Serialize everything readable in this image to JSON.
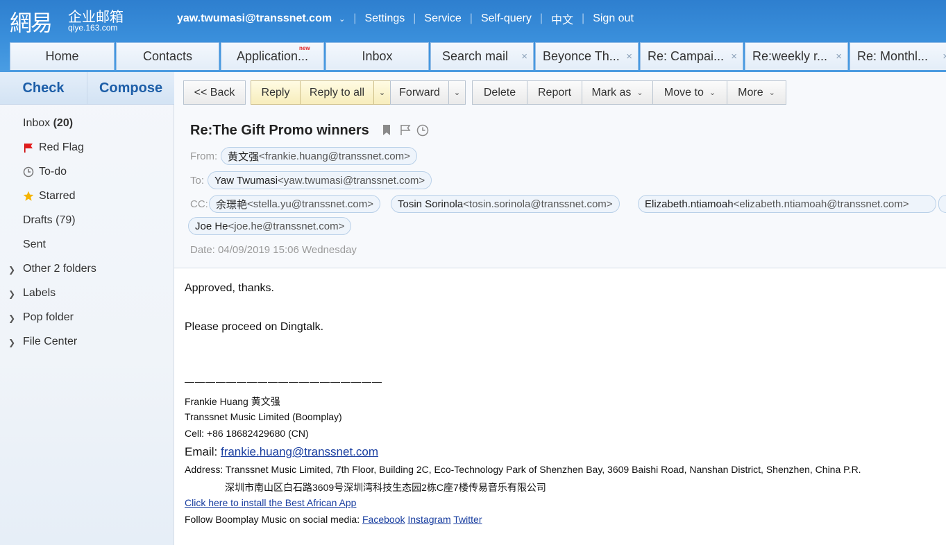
{
  "logo": {
    "big": "網易",
    "cn": "企业邮箱",
    "domain": "qiye.163.com"
  },
  "topnav": {
    "user": "yaw.twumasi@transsnet.com",
    "items": [
      "Settings",
      "Service",
      "Self-query",
      "中文",
      "Sign out"
    ]
  },
  "tabs": [
    {
      "label": "Home"
    },
    {
      "label": "Contacts"
    },
    {
      "label": "Application...",
      "badge": "new"
    },
    {
      "label": "Inbox"
    },
    {
      "label": "Search mail",
      "close": "×"
    },
    {
      "label": "Beyonce Th...",
      "close": "×"
    },
    {
      "label": "Re: Campai...",
      "close": "×"
    },
    {
      "label": "Re:weekly r...",
      "close": "×"
    },
    {
      "label": "Re: Monthl...",
      "close": "×"
    }
  ],
  "sidebar": {
    "check": "Check",
    "compose": "Compose",
    "inbox_label": "Inbox",
    "inbox_count": "(20)",
    "red_flag": "Red Flag",
    "todo": "To-do",
    "starred": "Starred",
    "drafts": "Drafts (79)",
    "sent": "Sent",
    "other": "Other 2 folders",
    "labels": "Labels",
    "pop": "Pop folder",
    "file_center": "File Center"
  },
  "toolbar": {
    "back": "<< Back",
    "reply": "Reply",
    "reply_all": "Reply to all",
    "forward": "Forward",
    "delete": "Delete",
    "report": "Report",
    "mark_as": "Mark as",
    "move_to": "Move to",
    "more": "More"
  },
  "mail": {
    "subject": "Re:The Gift Promo winners",
    "from_label": "From:",
    "from_name": "黄文强",
    "from_addr": "<frankie.huang@transsnet.com>",
    "to_label": "To:",
    "to_name": "Yaw Twumasi",
    "to_addr": "<yaw.twumasi@transsnet.com>",
    "cc_label": "CC:",
    "cc": [
      {
        "name": "余璟艳",
        "addr": "<stella.yu@transsnet.com>"
      },
      {
        "name": "Tosin Sorinola",
        "addr": "<tosin.sorinola@transsnet.com>"
      },
      {
        "name": "Elizabeth.ntiamoah",
        "addr": "<elizabeth.ntiamoah@transsnet.com>"
      },
      {
        "name": "Joe He",
        "addr": "<joe.he@transsnet.com>"
      }
    ],
    "date_label": "Date:",
    "date": "04/09/2019 15:06 Wednesday"
  },
  "body": {
    "line1": "Approved, thanks.",
    "line2": "Please proceed on Dingtalk.",
    "rule": "———————————————————",
    "sig_name": "Frankie Huang 黄文强",
    "sig_company": "Transsnet Music Limited (Boomplay)",
    "sig_cell": "Cell:  +86 18682429680 (CN)",
    "sig_email_label": "Email: ",
    "sig_email": "frankie.huang@transsnet.com",
    "sig_address_label": "Address:  ",
    "sig_address": "Transsnet Music Limited, 7th Floor, Building 2C, Eco-Technology Park of Shenzhen Bay, 3609 Baishi Road, Nanshan District, Shenzhen, China P.R.",
    "sig_address_cn": "深圳市南山区白石路3609号深圳湾科技生态园2栋C座7楼传易音乐有限公司",
    "install_link": "Click here to install the Best African App",
    "follow": "Follow Boomplay Music on social media: ",
    "facebook": "Facebook",
    "instagram": "Instagram",
    "twitter": "Twitter"
  },
  "colors": {
    "header_blue": "#3a8fdb",
    "link": "#1a3fa0",
    "accent_text": "#1d5ea8"
  }
}
